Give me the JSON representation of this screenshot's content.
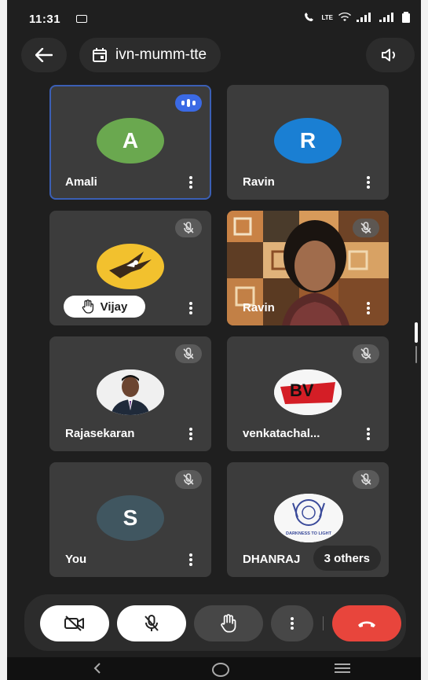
{
  "status": {
    "time": "11:31",
    "network": "LTE"
  },
  "meeting": {
    "code": "ivn-mumm-tte"
  },
  "tiles": [
    {
      "name": "Amali",
      "initial": "A",
      "color": "#6aa84f"
    },
    {
      "name": "Ravin",
      "initial": "R",
      "color": "#1a7fd3"
    },
    {
      "name": "Vijay"
    },
    {
      "name": "Ravin"
    },
    {
      "name": "Rajasekaran"
    },
    {
      "name": "venkatachal..."
    },
    {
      "name": "You",
      "initial": "S",
      "color": "#405660"
    },
    {
      "name": "DHANRAJ",
      "logo_text": "DARKNESS TO LIGHT"
    }
  ],
  "others_label": "3 others",
  "logo_bv": "BV",
  "colors": {
    "end_call": "#e8453c",
    "active_border": "#3b5fb5"
  }
}
